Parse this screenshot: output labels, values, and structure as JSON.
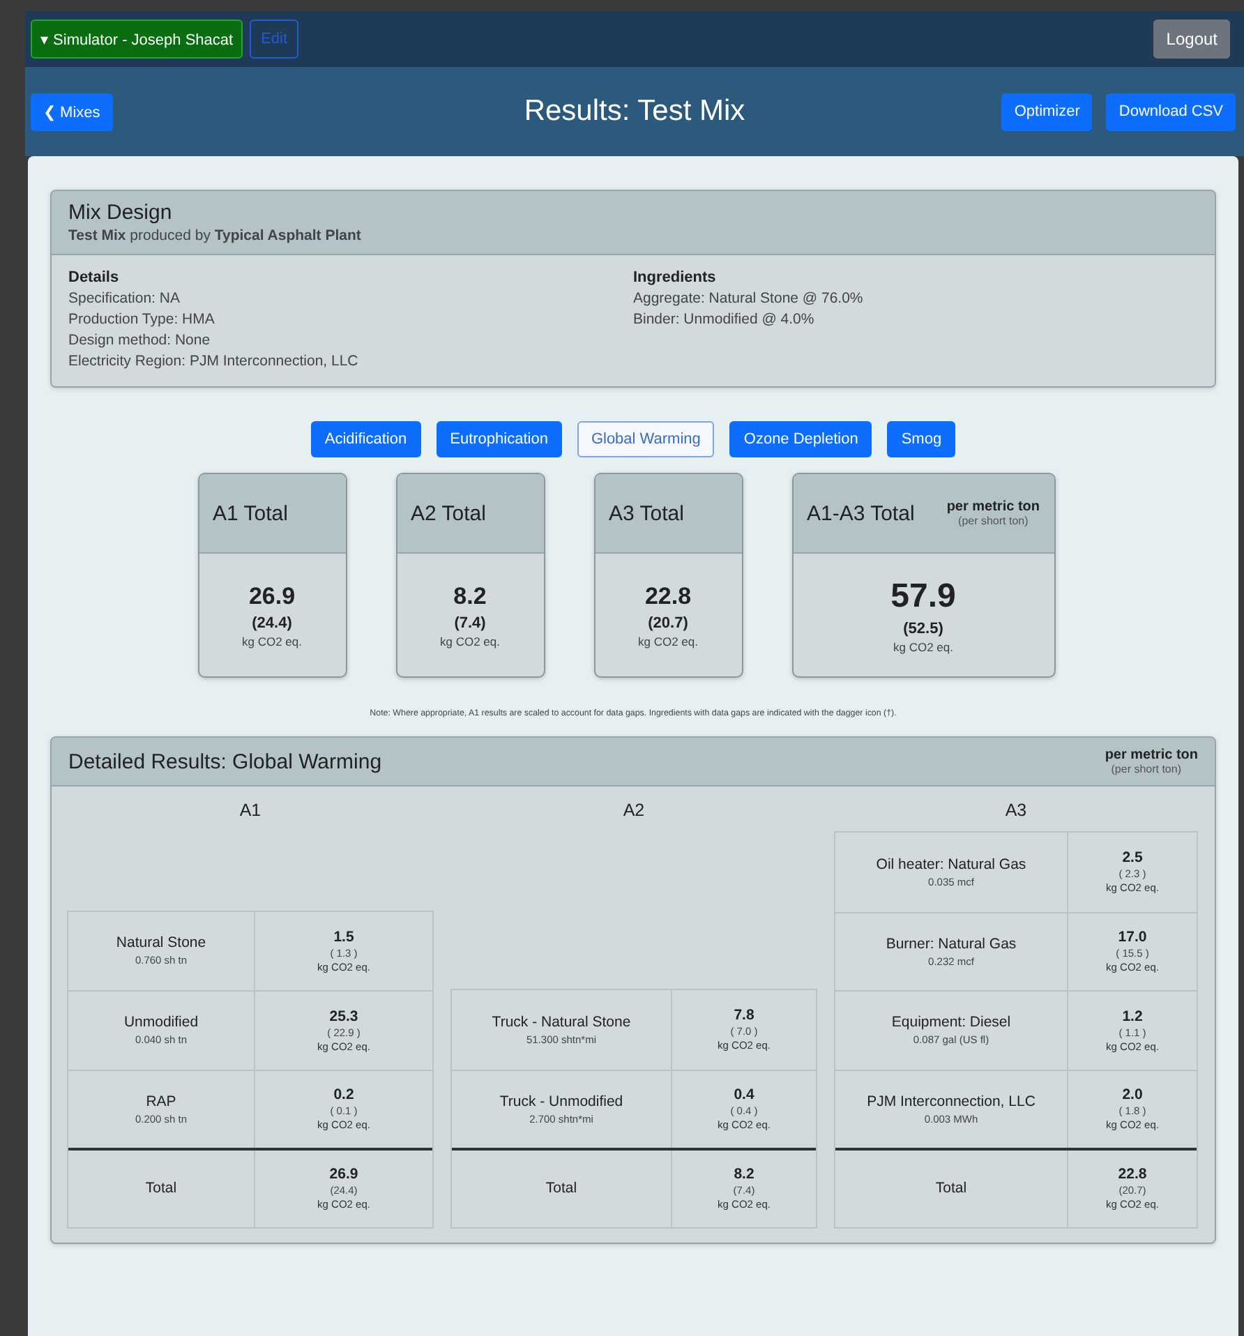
{
  "top_bar": {
    "simulator_menu": {
      "caret": "▾",
      "label": "Simulator - Joseph Shacat"
    },
    "edit_button": "Edit",
    "logout_button": "Logout"
  },
  "header": {
    "back_button": {
      "icon": "❮",
      "label": "Mixes"
    },
    "title": "Results: Test Mix",
    "buttons": [
      "Optimizer",
      "Download CSV"
    ]
  },
  "mix_design": {
    "title": "Mix Design",
    "subtitle": "**Test Mix** produced by **Typical Asphalt Plant**",
    "details": {
      "heading": "Details",
      "lines": [
        "Specification: NA",
        "Production Type: HMA",
        "Design method: None",
        "Electricity Region: PJM Interconnection, LLC"
      ]
    },
    "ingredients": {
      "heading": "Ingredients",
      "lines": [
        "Aggregate: Natural Stone @ 76.0%",
        "Binder: Unmodified @ 4.0%"
      ]
    }
  },
  "impact_tabs": [
    {
      "label": "Acidification",
      "selected": false
    },
    {
      "label": "Eutrophication",
      "selected": false
    },
    {
      "label": "Global Warming",
      "selected": true
    },
    {
      "label": "Ozone Depletion",
      "selected": false
    },
    {
      "label": "Smog",
      "selected": false
    }
  ],
  "summary_cards": [
    {
      "kind": "stage",
      "title": "A1 Total",
      "value": "26.9",
      "short": "(24.4)",
      "unit": "kg CO2 eq."
    },
    {
      "kind": "stage",
      "title": "A2 Total",
      "value": "8.2",
      "short": "(7.4)",
      "unit": "kg CO2 eq."
    },
    {
      "kind": "stage",
      "title": "A3 Total",
      "value": "22.8",
      "short": "(20.7)",
      "unit": "kg CO2 eq."
    },
    {
      "kind": "overall",
      "title": "A1-A3 Total",
      "basis": "per metric ton",
      "basis_short": "(per short ton)",
      "value": "57.9",
      "short": "(52.5)",
      "unit": "kg CO2 eq."
    }
  ],
  "note": "Note: Where appropriate, A1 results are scaled to account for data gaps. Ingredients with data gaps are indicated with the dagger icon (†).",
  "detailed_results": {
    "title": "Detailed Results: Global Warming",
    "basis": "per metric ton",
    "basis_short": "(per short ton)",
    "stages": [
      {
        "heading": "A1",
        "rows": [
          {
            "name": "Natural Stone",
            "amount": "0.760 sh tn",
            "value": "1.5",
            "short": "( 1.3 )",
            "unit": "kg CO2 eq."
          },
          {
            "name": "Unmodified",
            "amount": "0.040 sh tn",
            "value": "25.3",
            "short": "( 22.9 )",
            "unit": "kg CO2 eq."
          },
          {
            "name": "RAP",
            "amount": "0.200 sh tn",
            "value": "0.2",
            "short": "( 0.1 )",
            "unit": "kg CO2 eq."
          }
        ],
        "total": {
          "label": "Total",
          "value": "26.9",
          "short": "(24.4)",
          "unit": "kg CO2 eq."
        }
      },
      {
        "heading": "A2",
        "rows": [
          {
            "name": "Truck - Natural Stone",
            "amount": "51.300 shtn*mi",
            "value": "7.8",
            "short": "( 7.0 )",
            "unit": "kg CO2 eq."
          },
          {
            "name": "Truck - Unmodified",
            "amount": "2.700 shtn*mi",
            "value": "0.4",
            "short": "( 0.4 )",
            "unit": "kg CO2 eq."
          }
        ],
        "total": {
          "label": "Total",
          "value": "8.2",
          "short": "(7.4)",
          "unit": "kg CO2 eq."
        }
      },
      {
        "heading": "A3",
        "rows": [
          {
            "name": "Oil heater: Natural Gas",
            "amount": "0.035 mcf",
            "value": "2.5",
            "short": "( 2.3 )",
            "unit": "kg CO2 eq."
          },
          {
            "name": "Burner: Natural Gas",
            "amount": "0.232 mcf",
            "value": "17.0",
            "short": "( 15.5 )",
            "unit": "kg CO2 eq."
          },
          {
            "name": "Equipment: Diesel",
            "amount": "0.087 gal (US fl)",
            "value": "1.2",
            "short": "( 1.1 )",
            "unit": "kg CO2 eq."
          },
          {
            "name": "PJM Interconnection, LLC",
            "amount": "0.003 MWh",
            "value": "2.0",
            "short": "( 1.8 )",
            "unit": "kg CO2 eq."
          }
        ],
        "total": {
          "label": "Total",
          "value": "22.8",
          "short": "(20.7)",
          "unit": "kg CO2 eq."
        }
      }
    ]
  }
}
